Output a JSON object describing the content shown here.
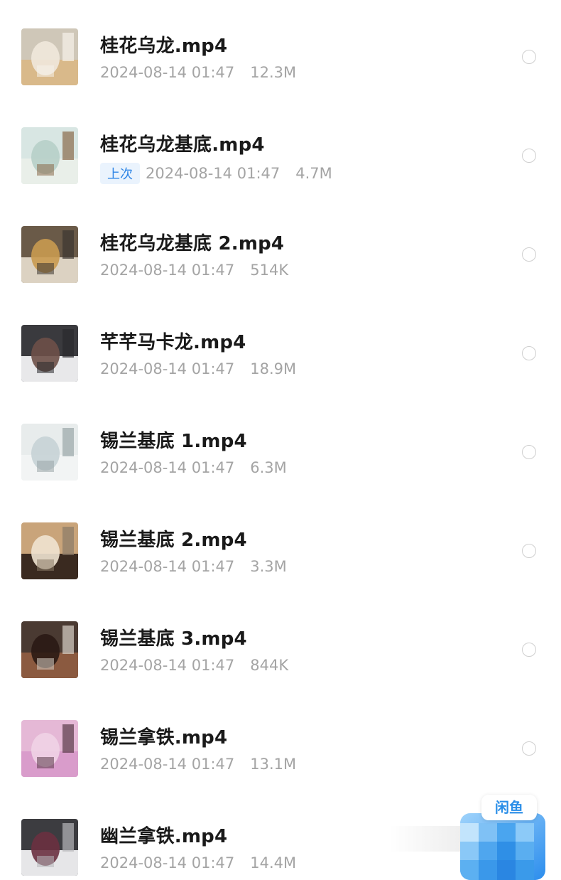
{
  "files": [
    {
      "name": "桂花乌龙.mp4",
      "date": "2024-08-14 01:47",
      "size": "12.3M",
      "badge": "",
      "thumb_icon": "video-thumbnail"
    },
    {
      "name": "桂花乌龙基底.mp4",
      "date": "2024-08-14 01:47",
      "size": "4.7M",
      "badge": "上次",
      "thumb_icon": "video-thumbnail"
    },
    {
      "name": "桂花乌龙基底 2.mp4",
      "date": "2024-08-14 01:47",
      "size": "514K",
      "badge": "",
      "thumb_icon": "video-thumbnail"
    },
    {
      "name": "芊芊马卡龙.mp4",
      "date": "2024-08-14 01:47",
      "size": "18.9M",
      "badge": "",
      "thumb_icon": "video-thumbnail"
    },
    {
      "name": "锡兰基底 1.mp4",
      "date": "2024-08-14 01:47",
      "size": "6.3M",
      "badge": "",
      "thumb_icon": "video-thumbnail"
    },
    {
      "name": "锡兰基底 2.mp4",
      "date": "2024-08-14 01:47",
      "size": "3.3M",
      "badge": "",
      "thumb_icon": "video-thumbnail"
    },
    {
      "name": "锡兰基底 3.mp4",
      "date": "2024-08-14 01:47",
      "size": "844K",
      "badge": "",
      "thumb_icon": "video-thumbnail"
    },
    {
      "name": "锡兰拿铁.mp4",
      "date": "2024-08-14 01:47",
      "size": "13.1M",
      "badge": "",
      "thumb_icon": "video-thumbnail"
    },
    {
      "name": "幽兰拿铁.mp4",
      "date": "2024-08-14 01:47",
      "size": "14.4M",
      "badge": "",
      "thumb_icon": "video-thumbnail"
    }
  ],
  "floating_app": {
    "label": "闲鱼",
    "icon": "xianyu-app-icon"
  },
  "colors": {
    "name_text": "#1a1a1a",
    "meta_text": "#a4a4a4",
    "badge_bg": "#eaf3fd",
    "badge_text": "#2f86e6",
    "radio_border": "#cfcfcf",
    "accent": "#2a8ee8"
  }
}
